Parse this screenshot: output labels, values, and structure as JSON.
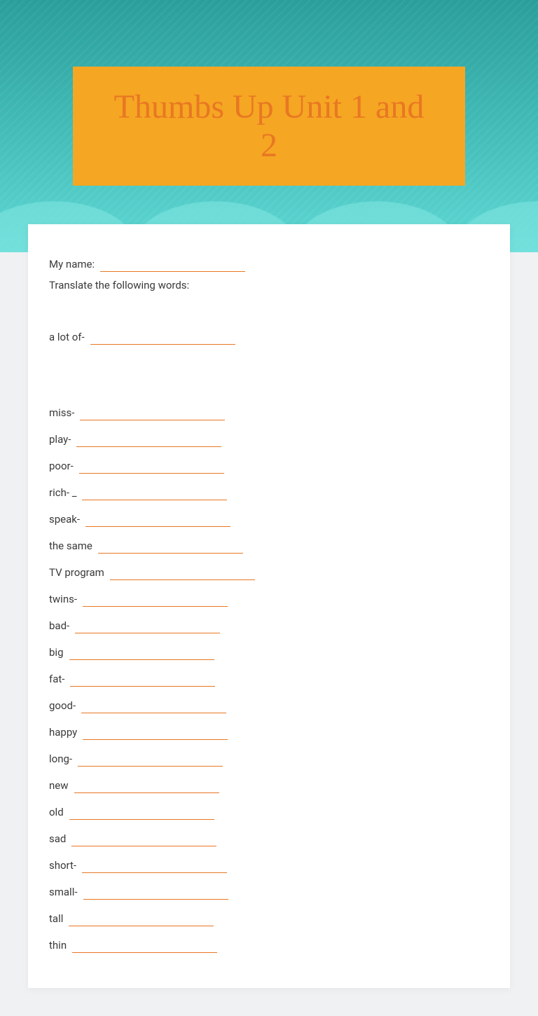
{
  "header": {
    "title": "Thumbs Up Unit 1 and 2"
  },
  "worksheet": {
    "name_label": "My name:",
    "instruction": "Translate the following words:",
    "items": [
      {
        "label": "a lot of-"
      },
      {
        "label": "miss-"
      },
      {
        "label": "play-"
      },
      {
        "label": "poor-"
      },
      {
        "label": "rich- _"
      },
      {
        "label": "speak-"
      },
      {
        "label": "the same"
      },
      {
        "label": "TV program"
      },
      {
        "label": "twins-"
      },
      {
        "label": "bad-"
      },
      {
        "label": "big"
      },
      {
        "label": "fat-"
      },
      {
        "label": "good-"
      },
      {
        "label": "happy"
      },
      {
        "label": "long-"
      },
      {
        "label": "new"
      },
      {
        "label": "old"
      },
      {
        "label": "sad"
      },
      {
        "label": "short-"
      },
      {
        "label": "small-"
      },
      {
        "label": "tall"
      },
      {
        "label": "thin"
      }
    ]
  }
}
